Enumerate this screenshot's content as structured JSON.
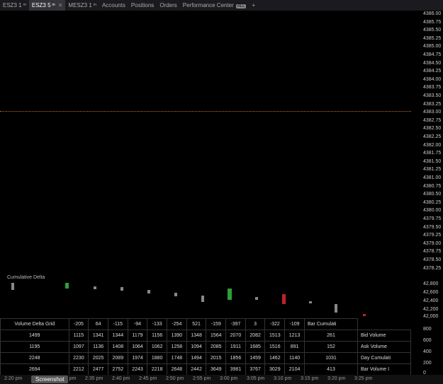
{
  "tabs": [
    {
      "label": "ESZ3 1",
      "sup": "m",
      "active": false
    },
    {
      "label": "ESZ3 5",
      "sup": "m",
      "active": true
    },
    {
      "label": "MESZ3 1",
      "sup": "m",
      "active": false
    }
  ],
  "nav": [
    "Accounts",
    "Positions",
    "Orders",
    "Performance Center"
  ],
  "nav_badge": "ALL",
  "add_tab": "+",
  "price_axis": [
    "4386.00",
    "4385.75",
    "4385.50",
    "4385.25",
    "4385.00",
    "4384.75",
    "4384.50",
    "4384.25",
    "4384.00",
    "4383.75",
    "4383.50",
    "4383.25",
    "4383.00",
    "4382.75",
    "4382.50",
    "4382.25",
    "4382.00",
    "4381.75",
    "4381.50",
    "4381.25",
    "4381.00",
    "4380.75",
    "4380.50",
    "4380.25",
    "4380.00",
    "4379.75",
    "4379.50",
    "4379.25",
    "4379.00",
    "4378.75",
    "4378.50",
    "4378.25"
  ],
  "cd_label": "Cumulative Delta",
  "cd_axis": [
    "42,800",
    "42,600",
    "42,400",
    "42,200",
    "42,000"
  ],
  "grid_axis": [
    "800",
    "600",
    "400",
    "200",
    "0"
  ],
  "rows": [
    {
      "label": "Bar Cumulati",
      "vals": [
        "Volume Delta Grid",
        "-205",
        "64",
        "-115",
        "-94",
        "-133",
        "-254",
        "521",
        "-159",
        "-397",
        "3",
        "-322",
        "-109"
      ],
      "signs": [
        "n",
        "r",
        "g",
        "r",
        "r",
        "r",
        "r",
        "g",
        "r",
        "r",
        "g",
        "r",
        "r"
      ]
    },
    {
      "label": "Bid Volume",
      "vals": [
        "1499",
        "1115",
        "1341",
        "1344",
        "1179",
        "1156",
        "1390",
        "1348",
        "1564",
        "2070",
        "2082",
        "1513",
        "1213",
        "261"
      ]
    },
    {
      "label": "Ask Volume",
      "vals": [
        "1195",
        "1097",
        "1136",
        "1408",
        "1064",
        "1062",
        "1258",
        "1094",
        "2085",
        "1911",
        "1685",
        "1516",
        "891",
        "152"
      ]
    },
    {
      "label": "Day Cumulati",
      "vals": [
        "2248",
        "2230",
        "2025",
        "2089",
        "1974",
        "1880",
        "1748",
        "1494",
        "2015",
        "1856",
        "1459",
        "1462",
        "1140",
        "1031"
      ],
      "green": true
    },
    {
      "label": "Bar Volume I",
      "vals": [
        "2694",
        "2212",
        "2477",
        "2752",
        "2243",
        "2218",
        "2648",
        "2442",
        "3649",
        "3981",
        "3767",
        "3029",
        "2104",
        "413"
      ]
    }
  ],
  "time_labels": [
    "2:20 pm",
    "2:25 pm",
    "2:30 pm",
    "2:35 pm",
    "2:40 pm",
    "2:45 pm",
    "2:50 pm",
    "2:55 pm",
    "3:00 pm",
    "3:05 pm",
    "3:10 pm",
    "3:15 pm",
    "3:20 pm",
    "3:25 pm"
  ],
  "screenshot_button": "Screenshot",
  "accent_green": "#2e9e3a",
  "accent_red": "#c0202d"
}
